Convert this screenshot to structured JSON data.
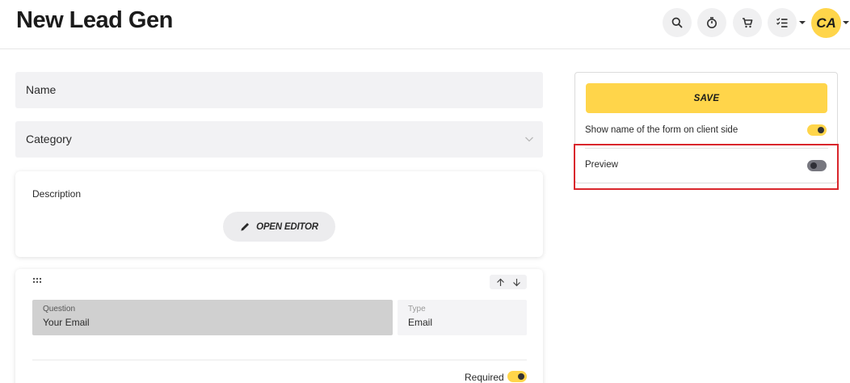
{
  "header": {
    "title": "New Lead Gen",
    "avatar_initials": "CA"
  },
  "form": {
    "name_placeholder": "Name",
    "category_placeholder": "Category",
    "description_label": "Description",
    "open_editor_label": "OPEN EDITOR",
    "question": {
      "question_label": "Question",
      "question_value": "Your Email",
      "type_label": "Type",
      "type_value": "Email",
      "required_label": "Required",
      "required_on": true
    }
  },
  "panel": {
    "save_label": "SAVE",
    "show_name_label": "Show name of the form on client side",
    "show_name_on": true,
    "preview_label": "Preview",
    "preview_on": false
  },
  "colors": {
    "accent": "#ffd54a",
    "highlight": "#d9262c"
  }
}
